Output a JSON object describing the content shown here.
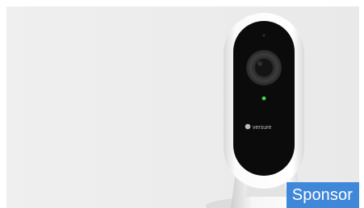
{
  "ad": {
    "sponsor_label": "Sponsor",
    "product_brand": "Versure",
    "image_subject": "security-camera-icon"
  },
  "colors": {
    "background": "#ededed",
    "badge": "#3f87d9",
    "badge_text": "#ffffff",
    "camera_shell": "#f7f7f7",
    "camera_face": "#0c0c0c",
    "status_led": "#4ad05a"
  }
}
